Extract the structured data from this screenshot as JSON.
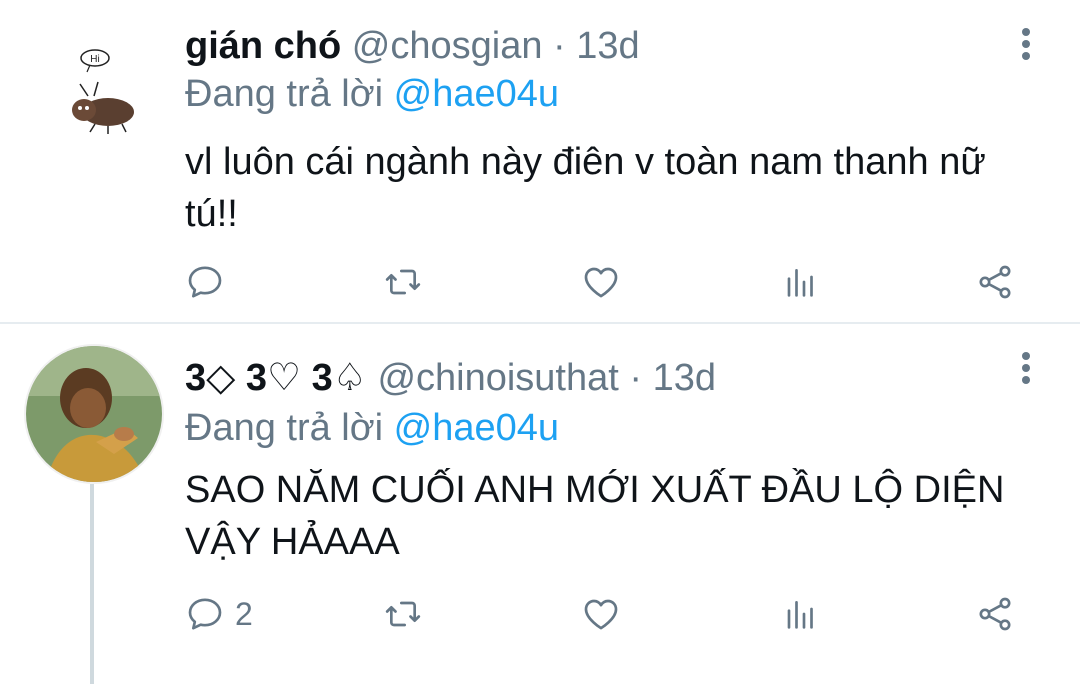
{
  "tweets": [
    {
      "name": "gián chó",
      "handle": "@chosgian",
      "separator": "·",
      "time": "13d",
      "reply_prefix": "Đang trả lời",
      "reply_to": "@hae04u",
      "text": "vl luôn cái ngành này điên v toàn nam thanh nữ tú!!",
      "avatar_bubble": "Hi",
      "reply_count": ""
    },
    {
      "name": "3◇ 3♡ 3♤",
      "handle": "@chinoisuthat",
      "separator": "·",
      "time": "13d",
      "reply_prefix": "Đang trả lời",
      "reply_to": "@hae04u",
      "text": "SAO NĂM CUỐI ANH MỚI XUẤT ĐẦU LỘ DIỆN VẬY HẢAAA",
      "reply_count": "2"
    }
  ],
  "icons": {
    "reply": "comment-icon",
    "retweet": "retweet-icon",
    "like": "heart-icon",
    "stats": "bar-chart-icon",
    "share": "share-icon",
    "more": "more-vertical-icon"
  },
  "colors": {
    "text": "#0f1419",
    "secondary": "#657786",
    "link": "#1da1f2",
    "divider": "#e6ecf0"
  }
}
